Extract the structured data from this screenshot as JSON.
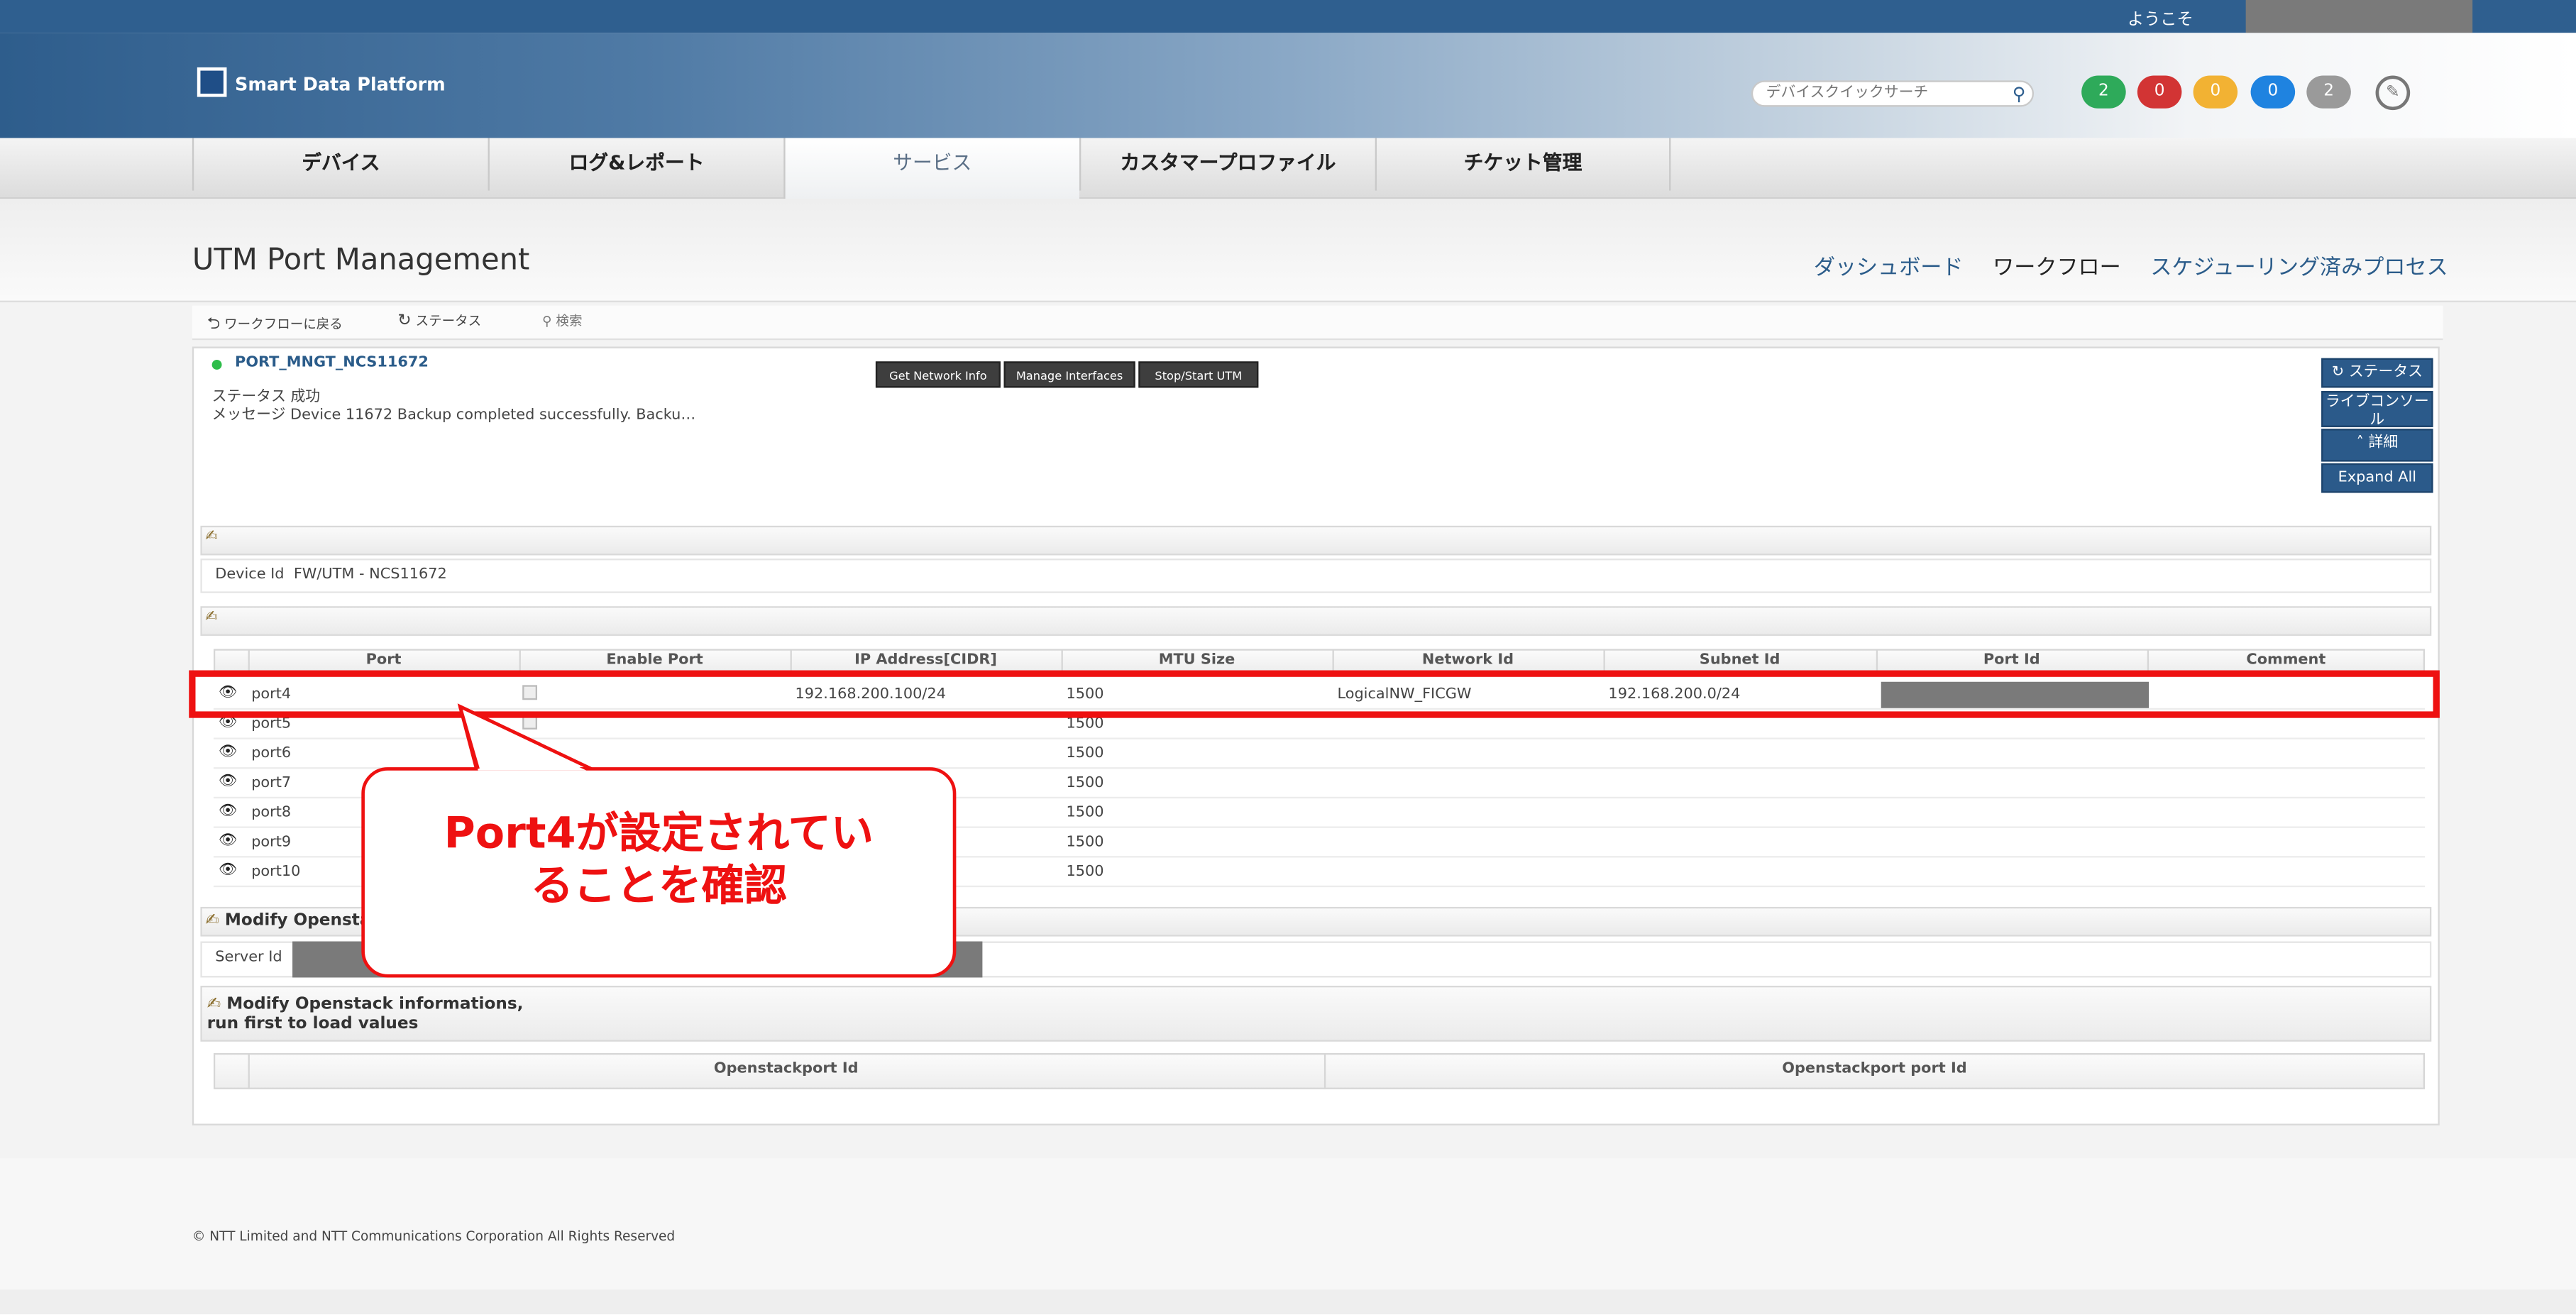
{
  "header": {
    "welcome": "ようこそ",
    "logo_text": "Smart Data Platform",
    "search_placeholder": "デバイスクイックサーチ",
    "badges": [
      {
        "count": "2",
        "color": "#2eaa5a"
      },
      {
        "count": "0",
        "color": "#d23434"
      },
      {
        "count": "0",
        "color": "#f2b233"
      },
      {
        "count": "0",
        "color": "#1f83e0"
      },
      {
        "count": "2",
        "color": "#9a9a9a"
      }
    ]
  },
  "nav": {
    "tabs": [
      "デバイス",
      "ログ&レポート",
      "サービス",
      "カスタマープロファイル",
      "チケット管理"
    ],
    "active": "サービス"
  },
  "page": {
    "title": "UTM Port Management",
    "links": [
      "ダッシュボード",
      "ワークフロー",
      "スケジューリング済みプロセス"
    ]
  },
  "toolbar": {
    "back": "ワークフローに戻る",
    "status": "ステータス",
    "search": "検索"
  },
  "service": {
    "name": "PORT_MNGT_NCS11672",
    "status": "ステータス 成功",
    "message": "メッセージ Device 11672 Backup completed successfully. Backu…",
    "buttons": [
      "Get Network Info",
      "Manage Interfaces",
      "Stop/Start UTM"
    ],
    "side_buttons": [
      "ステータス",
      "ライブコンソール",
      "詳細",
      "Expand All"
    ]
  },
  "device": {
    "label": "Device Id",
    "value": "FW/UTM - NCS11672"
  },
  "ports_table": {
    "columns": [
      "Port",
      "Enable Port",
      "IP Address[CIDR]",
      "MTU Size",
      "Network Id",
      "Subnet Id",
      "Port Id",
      "Comment"
    ],
    "rows": [
      {
        "port": "port4",
        "ip": "192.168.200.100/24",
        "mtu": "1500",
        "network": "LogicalNW_FICGW",
        "subnet": "192.168.200.0/24"
      },
      {
        "port": "port5",
        "ip": "",
        "mtu": "1500",
        "network": "",
        "subnet": ""
      },
      {
        "port": "port6",
        "ip": "",
        "mtu": "1500",
        "network": "",
        "subnet": ""
      },
      {
        "port": "port7",
        "ip": "",
        "mtu": "1500",
        "network": "",
        "subnet": ""
      },
      {
        "port": "port8",
        "ip": "",
        "mtu": "1500",
        "network": "",
        "subnet": ""
      },
      {
        "port": "port9",
        "ip": "",
        "mtu": "1500",
        "network": "",
        "subnet": ""
      },
      {
        "port": "port10",
        "ip": "",
        "mtu": "1500",
        "network": "",
        "subnet": ""
      }
    ]
  },
  "callout": {
    "line1": "Port4が設定されてい",
    "line2": "ることを確認"
  },
  "openstack1": {
    "title": "Modify Openstac",
    "server_label": "Server Id"
  },
  "openstack2": {
    "title_line1": "Modify Openstack informations,",
    "title_line2": "run first to load values",
    "columns": [
      "Openstackport Id",
      "Openstackport port Id"
    ]
  },
  "footer": {
    "copyright": "© NTT Limited and NTT Communications Corporation All Rights Reserved"
  }
}
